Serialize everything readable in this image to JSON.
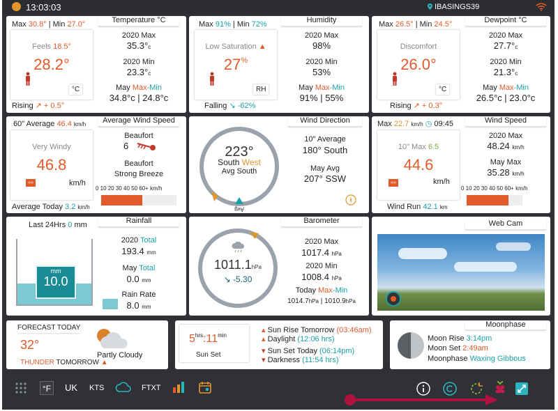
{
  "topbar": {
    "time": "13:03:03",
    "station": "IBASINGS39"
  },
  "temperature": {
    "max_label": "Max",
    "max": "30.8°",
    "min_label": "Min",
    "min": "27.0°",
    "feels_label": "Feels",
    "feels": "18.5°",
    "value": "28.2°",
    "unit": "°C",
    "trend_label": "Rising",
    "trend": "+ 0.5°",
    "title": "Temperature °C",
    "y_max_label": "2020 Max",
    "y_max": "35.3°",
    "y_max_unit": "c",
    "y_min_label": "2020 Min",
    "y_min": "23.3°",
    "y_min_unit": "c",
    "m_label_a": "May",
    "m_label_b": "Max",
    "m_label_c": "-Min",
    "m_vals": "34.8°c | 24.8°c"
  },
  "humidity": {
    "max_label": "Max",
    "max": "91%",
    "min_label": "Min",
    "min": "72%",
    "status": "Low Saturation",
    "value": "27",
    "unit": "%",
    "rh": "RH",
    "trend_label": "Falling",
    "trend": "-62%",
    "title": "Humidity",
    "y_max_label": "2020 Max",
    "y_max": "98%",
    "y_min_label": "2020 Min",
    "y_min": "53%",
    "m_label_a": "May",
    "m_label_b": "Max",
    "m_label_c": "-Min",
    "m_vals": "91% | 55%"
  },
  "dewpoint": {
    "max_label": "Max",
    "max": "26.5°",
    "min_label": "Min",
    "min": "24.5°",
    "status": "Discomfort",
    "value": "26.0°",
    "unit": "°C",
    "trend_label": "Rising",
    "trend": "+ 0.3°",
    "title": "Dewpoint °C",
    "y_max_label": "2020 Max",
    "y_max": "27.7°",
    "y_max_unit": "c",
    "y_min_label": "2020 Min",
    "y_min": "21.3°",
    "y_min_unit": "c",
    "m_label_a": "May",
    "m_label_b": "Max",
    "m_label_c": "-Min",
    "m_vals": "26.5°c | 23.0°c"
  },
  "avgwind": {
    "avg_label": "60\" Average",
    "avg": "46.4",
    "avg_unit": "km/h",
    "status": "Very Windy",
    "value": "46.8",
    "unit": "km/h",
    "today_label": "Average Today",
    "today": "3.2",
    "today_unit": "km/h",
    "title": "Average Wind Speed",
    "beaufort_label": "Beaufort",
    "beaufort": "6",
    "beaufort_label2": "Beaufort",
    "beaufort_desc": "Strong Breeze",
    "scale": "0 10 20 30 40 50 60+",
    "scale_unit": "km/h",
    "scale_fill": 0.55
  },
  "winddir": {
    "title": "Wind Direction",
    "deg": "223°",
    "dir_a": "South",
    "dir_b": "West",
    "avg_label": "Avg South",
    "avg_short": "Avg",
    "avg10_label": "10\" Average",
    "avg10_deg": "180°",
    "avg10_dir": "South",
    "mavg_label": "May Avg",
    "mavg_deg": "207°",
    "mavg_dir": "SSW"
  },
  "windspeed": {
    "max_label": "Max",
    "max": "22.7",
    "max_unit": "km/h",
    "max_time": "09:45",
    "title": "Wind Speed",
    "ten_label": "10\" Max",
    "ten": "6.5",
    "value": "44.6",
    "unit": "km/h",
    "run_label": "Wind Run",
    "run": "42.1",
    "run_unit": "km",
    "y_max_label": "2020 Max",
    "y_max": "48.24",
    "y_unit": "km/h",
    "m_max_label": "May Max",
    "m_max": "35.28",
    "scale": "0 10 20 30 40 50 60+",
    "scale_unit": "km/h",
    "scale_fill": 0.75
  },
  "rain": {
    "last_label": "Last 24Hrs",
    "last": "0",
    "last_unit": "mm",
    "unit": "mm",
    "value": "10.0",
    "title": "Rainfall",
    "total_label_a": "2020",
    "total_label_b": "Total",
    "total": "193.4",
    "total_unit": "mm",
    "may_label_a": "May",
    "may_label_b": "Total",
    "may": "0.0",
    "may_unit": "mm",
    "rate_label": "Rain Rate",
    "rate": "8.0",
    "rate_unit": "mm",
    "fill": 0.32
  },
  "barometer": {
    "title": "Barometer",
    "value": "1011.1",
    "unit": "hPa",
    "trend": "-5.30",
    "y_max_label": "2020 Max",
    "y_max": "1017.4",
    "y_min_label": "2020 Min",
    "y_min": "1008.4",
    "hpa": "hPa",
    "today_label": "Today",
    "today_b": "Max",
    "today_c": "-Min",
    "today_vals_a": "1014.7",
    "today_vals_b": "1010.9"
  },
  "webcam": {
    "title": "Web Cam"
  },
  "forecast": {
    "title": "FORECAST TODAY",
    "temp": "32°",
    "desc": "Partly Cloudy",
    "warn_a": "THUNDER",
    "warn_b": "TOMORROW"
  },
  "sun": {
    "hrs": "5",
    "hrs_unit": "hrs",
    "min": "11",
    "min_unit": "min",
    "label": "Sun Set",
    "rise_label": "Sun Rise Tomorrow",
    "rise": "(03:46am)",
    "daylight_label": "Daylight",
    "daylight": "(12:06 hrs)",
    "set_label": "Sun Set Today",
    "set": "(06:14pm)",
    "dark_label": "Darkness",
    "dark": "(11:54 hrs)"
  },
  "moon": {
    "title": "Moonphase",
    "rise_label": "Moon Rise",
    "rise": "3:14pm",
    "set_label": "Moon Set",
    "set": "2:49am",
    "phase_label": "Moonphase",
    "phase": "Waxing Gibbous"
  },
  "bottombar": {
    "f": "°F",
    "uk": "UK",
    "kts": "KTS",
    "ftxt": "FTXT"
  },
  "colors": {
    "accent": "#e05a2b",
    "teal": "#1aa0a8",
    "frame": "#2f3136"
  }
}
